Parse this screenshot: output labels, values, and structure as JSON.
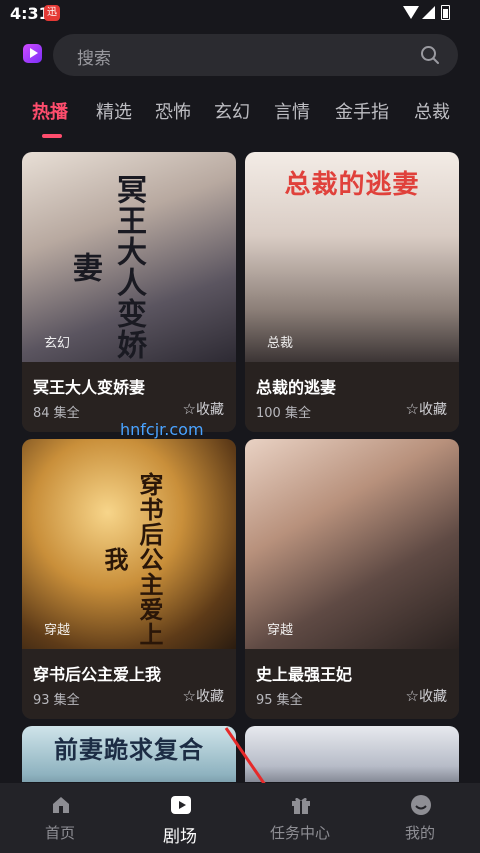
{
  "status_bar": {
    "time": "4:31",
    "notif_badge": "迅"
  },
  "search": {
    "placeholder": "搜索"
  },
  "tabs": [
    {
      "label": "热播",
      "active": true
    },
    {
      "label": "精选"
    },
    {
      "label": "恐怖"
    },
    {
      "label": "玄幻"
    },
    {
      "label": "言情"
    },
    {
      "label": "金手指"
    },
    {
      "label": "总裁"
    }
  ],
  "cards": [
    {
      "title": "冥王大人变娇妻",
      "episodes": "84 集全",
      "genre": "玄幻",
      "cover_text": "冥王大人变娇妻",
      "fav": "收藏"
    },
    {
      "title": "总裁的逃妻",
      "episodes": "100 集全",
      "genre": "总裁",
      "cover_text": "总裁的逃妻",
      "fav": "收藏"
    },
    {
      "title": "穿书后公主爱上我",
      "episodes": "93 集全",
      "genre": "穿越",
      "cover_text": "穿书后公主爱上我",
      "fav": "收藏"
    },
    {
      "title": "史上最强王妃",
      "episodes": "95 集全",
      "genre": "穿越",
      "cover_text": "",
      "fav": "收藏"
    },
    {
      "cover_text": "前妻跪求复合"
    },
    {
      "cover_text": ""
    }
  ],
  "watermark": "hnfcjr.com",
  "bottom_nav": [
    {
      "label": "首页",
      "icon": "home-icon"
    },
    {
      "label": "剧场",
      "icon": "play-icon",
      "active": true
    },
    {
      "label": "任务中心",
      "icon": "gift-icon"
    },
    {
      "label": "我的",
      "icon": "profile-icon"
    }
  ],
  "colors": {
    "accent": "#ff4d6d",
    "background": "#17171c",
    "nav_bg": "#232328"
  }
}
